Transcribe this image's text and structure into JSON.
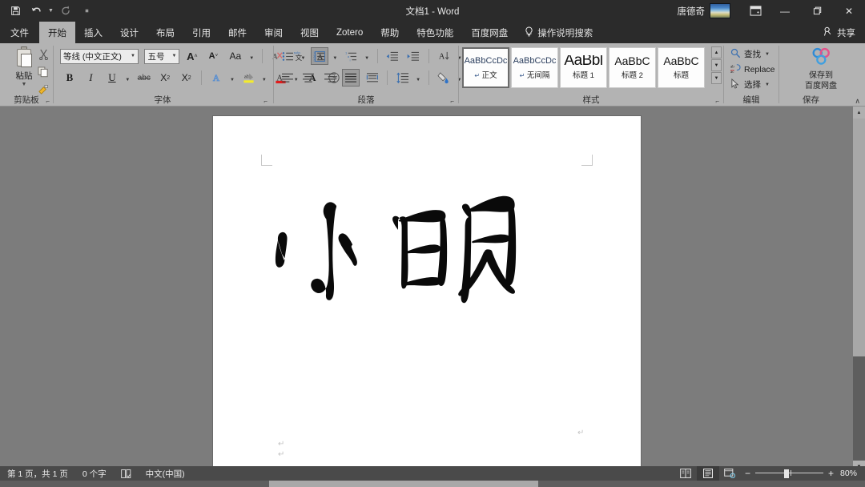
{
  "titlebar": {
    "title": "文档1  -  Word",
    "qat": [
      {
        "name": "save-icon",
        "glyph": "὚B"
      },
      {
        "name": "undo-icon",
        "glyph": "↶"
      },
      {
        "name": "redo-icon",
        "glyph": "↻"
      },
      {
        "name": "customize-qat-icon",
        "glyph": "▪"
      }
    ],
    "user_name": "唐德奇",
    "ribbon_display_options": "ribbon-display-options-icon",
    "minimize": "—",
    "restore": "❐",
    "close": "✕"
  },
  "tabs": [
    {
      "label": "文件",
      "active": false,
      "file": true
    },
    {
      "label": "开始",
      "active": true
    },
    {
      "label": "插入",
      "active": false
    },
    {
      "label": "设计",
      "active": false
    },
    {
      "label": "布局",
      "active": false
    },
    {
      "label": "引用",
      "active": false
    },
    {
      "label": "邮件",
      "active": false
    },
    {
      "label": "审阅",
      "active": false
    },
    {
      "label": "视图",
      "active": false
    },
    {
      "label": "Zotero",
      "active": false
    },
    {
      "label": "帮助",
      "active": false
    },
    {
      "label": "特色功能",
      "active": false
    },
    {
      "label": "百度网盘",
      "active": false
    }
  ],
  "tell_me": "操作说明搜索",
  "share": "共享",
  "ribbon": {
    "groups": {
      "clipboard": {
        "label": "剪贴板",
        "paste_label": "粘贴",
        "buttons": [
          "cut-icon",
          "copy-icon",
          "format-painter-icon"
        ]
      },
      "font": {
        "label": "字体",
        "font_name": "等线 (中文正文)",
        "font_size": "五号",
        "row1": [
          "grow-font-A",
          "shrink-font-A",
          "change-case-Aa",
          "clear-formatting",
          "phonetic-guide",
          "character-border"
        ],
        "row2": [
          "B",
          "I",
          "U",
          "abc",
          "X₂",
          "X²",
          "text-effects-A",
          "highlight-abc",
          "font-color-A",
          "character-shading-A",
          "enclose-characters"
        ]
      },
      "paragraph": {
        "label": "段落",
        "row1": [
          "bullets-icon",
          "numbering-icon",
          "multilevel-list-icon",
          "decrease-indent-icon",
          "increase-indent-icon",
          "sort-icon",
          "show-marks-icon"
        ],
        "row2": [
          "align-left-icon",
          "align-center-icon",
          "align-right-icon",
          "justify-icon",
          "distributed-icon",
          "line-spacing-icon",
          "shading-icon",
          "borders-icon"
        ]
      },
      "styles": {
        "label": "样式",
        "items": [
          {
            "preview": "AaBbCcDc",
            "name": "正文",
            "kind": "body",
            "pilcrow": "↵",
            "active": true
          },
          {
            "preview": "AaBbCcDc",
            "name": "无间隔",
            "kind": "body",
            "pilcrow": "↵",
            "active": false
          },
          {
            "preview": "AaBbl",
            "name": "标题 1",
            "kind": "h1",
            "pilcrow": "",
            "active": false
          },
          {
            "preview": "AaBbC",
            "name": "标题 2",
            "kind": "h2",
            "pilcrow": "",
            "active": false
          },
          {
            "preview": "AaBbC",
            "name": "标题",
            "kind": "ti",
            "pilcrow": "",
            "active": false
          }
        ]
      },
      "editing": {
        "label": "编辑",
        "find": "查找",
        "replace": "Replace",
        "select": "选择"
      },
      "save": {
        "label": "保存",
        "baidu_line1": "保存到",
        "baidu_line2": "百度网盘"
      }
    },
    "collapse": "∧"
  },
  "document": {
    "signature_alt": "小明",
    "paragraph_marks": [
      "↵",
      "↵",
      "↵"
    ]
  },
  "statusbar": {
    "page_info": "第 1 页，共 1 页",
    "word_count": "0 个字",
    "proofing_icon": "proofing-errors-icon",
    "language": "中文(中国)",
    "views": [
      {
        "name": "read-mode-view",
        "active": false
      },
      {
        "name": "print-layout-view",
        "active": true
      },
      {
        "name": "web-layout-view",
        "active": false
      }
    ],
    "zoom_out": "−",
    "zoom_in": "+",
    "zoom_level": "80%"
  }
}
